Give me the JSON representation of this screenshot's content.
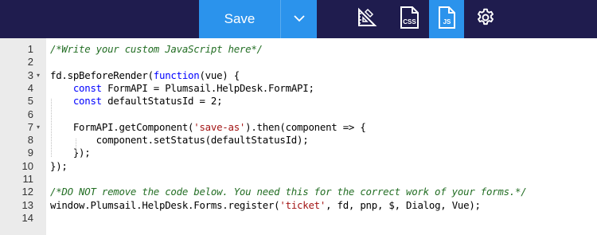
{
  "toolbar": {
    "save_label": "Save",
    "icons": [
      "ruler-triangle-icon",
      "css-file-icon",
      "js-file-icon",
      "gear-icon"
    ],
    "active_icon": "js-file-icon",
    "css_label": "CSS",
    "js_label": "JS"
  },
  "colors": {
    "toolbar_bg": "#1f1c4e",
    "accent": "#2b93ec",
    "comment": "#236e24",
    "keyword": "#0000ff",
    "string": "#a31515"
  },
  "editor": {
    "lines": [
      {
        "num": "1",
        "fold": false,
        "tokens": [
          {
            "t": "/*Write your custom JavaScript here*/",
            "c": "comment"
          }
        ]
      },
      {
        "num": "2",
        "fold": false,
        "tokens": []
      },
      {
        "num": "3",
        "fold": true,
        "tokens": [
          {
            "t": "fd.spBeforeRender(",
            "c": ""
          },
          {
            "t": "function",
            "c": "keyword"
          },
          {
            "t": "(vue) {",
            "c": ""
          }
        ]
      },
      {
        "num": "4",
        "fold": false,
        "tokens": [
          {
            "t": "    ",
            "c": ""
          },
          {
            "t": "const",
            "c": "keyword"
          },
          {
            "t": " FormAPI = Plumsail.HelpDesk.FormAPI;",
            "c": ""
          }
        ]
      },
      {
        "num": "5",
        "fold": false,
        "tokens": [
          {
            "t": "    ",
            "c": ""
          },
          {
            "t": "const",
            "c": "keyword"
          },
          {
            "t": " defaultStatusId = 2;",
            "c": ""
          }
        ]
      },
      {
        "num": "6",
        "fold": false,
        "tokens": []
      },
      {
        "num": "7",
        "fold": true,
        "tokens": [
          {
            "t": "    FormAPI.getComponent(",
            "c": ""
          },
          {
            "t": "'save-as'",
            "c": "string"
          },
          {
            "t": ").then(component => {",
            "c": ""
          }
        ]
      },
      {
        "num": "8",
        "fold": false,
        "tokens": [
          {
            "t": "        component.setStatus(defaultStatusId);",
            "c": ""
          }
        ]
      },
      {
        "num": "9",
        "fold": false,
        "tokens": [
          {
            "t": "    });",
            "c": ""
          }
        ]
      },
      {
        "num": "10",
        "fold": false,
        "tokens": [
          {
            "t": "});",
            "c": ""
          }
        ]
      },
      {
        "num": "11",
        "fold": false,
        "tokens": []
      },
      {
        "num": "12",
        "fold": false,
        "tokens": [
          {
            "t": "/*DO NOT remove the code below. You need this for the correct work of your forms.*/",
            "c": "comment"
          }
        ]
      },
      {
        "num": "13",
        "fold": false,
        "tokens": [
          {
            "t": "window.Plumsail.HelpDesk.Forms.register(",
            "c": ""
          },
          {
            "t": "'ticket'",
            "c": "string"
          },
          {
            "t": ", fd, pnp, $, Dialog, Vue);",
            "c": ""
          }
        ]
      },
      {
        "num": "14",
        "fold": false,
        "tokens": []
      }
    ]
  }
}
